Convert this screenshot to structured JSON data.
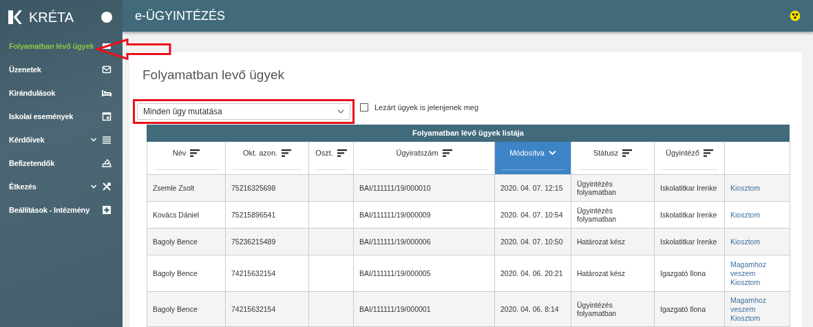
{
  "sidebar": {
    "brand": "KRÉTA",
    "items": [
      {
        "label": "Folyamatban lévő ügyek",
        "selected": true,
        "has_submenu": false,
        "arrow_marked": true
      },
      {
        "label": "Üzenetek",
        "selected": false,
        "has_submenu": false,
        "arrow_marked": false
      },
      {
        "label": "Kirándulások",
        "selected": false,
        "has_submenu": false,
        "arrow_marked": false
      },
      {
        "label": "Iskolai események",
        "selected": false,
        "has_submenu": false,
        "arrow_marked": false
      },
      {
        "label": "Kérdőívek",
        "selected": false,
        "has_submenu": true,
        "arrow_marked": false
      },
      {
        "label": "Befizetendők",
        "selected": false,
        "has_submenu": false,
        "arrow_marked": false
      },
      {
        "label": "Étkezés",
        "selected": false,
        "has_submenu": true,
        "arrow_marked": false
      },
      {
        "label": "Beállítások - Intézmény",
        "selected": false,
        "has_submenu": false,
        "arrow_marked": false
      }
    ]
  },
  "header": {
    "title": "e-ÜGYINTÉZÉS"
  },
  "page": {
    "title": "Folyamatban levő ügyek",
    "filter": {
      "value": "Minden ügy mutatása",
      "highlighted": true
    },
    "closed_toggle": {
      "label": "Lezárt ügyek is jelenjenek meg",
      "checked": false
    }
  },
  "table": {
    "title": "Folyamatban lévő ügyek listája",
    "columns": [
      {
        "label": "Név",
        "sorted": false
      },
      {
        "label": "Okt. azon.",
        "sorted": false
      },
      {
        "label": "Oszt.",
        "sorted": false
      },
      {
        "label": "Ügyiratszám",
        "sorted": false
      },
      {
        "label": "Módosítva",
        "sorted": true
      },
      {
        "label": "Státusz",
        "sorted": false
      },
      {
        "label": "Ügyintéző",
        "sorted": false
      }
    ],
    "rows": [
      {
        "cells": [
          "Zsemle Zsolt",
          "75216325698",
          "",
          "BAI/111111/19/000010",
          "2020. 04. 07. 12:15",
          "Ügyintézés folyamatban",
          "Iskolatitkar Irenke"
        ],
        "actions": [
          "Kiosztom"
        ]
      },
      {
        "cells": [
          "Kovács Dániel",
          "75215896541",
          "",
          "BAI/111111/19/000009",
          "2020. 04. 07. 10:54",
          "Ügyintézés folyamatban",
          "Iskolatitkar Irenke"
        ],
        "actions": [
          "Kiosztom"
        ]
      },
      {
        "cells": [
          "Bagoly Bence",
          "75236215489",
          "",
          "BAI/111111/19/000006",
          "2020. 04. 07. 10:50",
          "Határozat kész",
          "Iskolatitkar Irenke"
        ],
        "actions": [
          "Kiosztom"
        ]
      },
      {
        "cells": [
          "Bagoly Bence",
          "74215632154",
          "",
          "BAI/111111/19/000005",
          "2020. 04. 06. 20:21",
          "Határozat kész",
          "Igazgató Ilona"
        ],
        "actions": [
          "Magamhoz veszem",
          "Kiosztom"
        ]
      },
      {
        "cells": [
          "Bagoly Bence",
          "74215632154",
          "",
          "BAI/111111/19/000001",
          "2020. 04. 06. 8:14",
          "Ügyintézés folyamatban",
          "Igazgató Ilona"
        ],
        "actions": [
          "Magamhoz veszem",
          "Kiosztom"
        ]
      }
    ]
  }
}
